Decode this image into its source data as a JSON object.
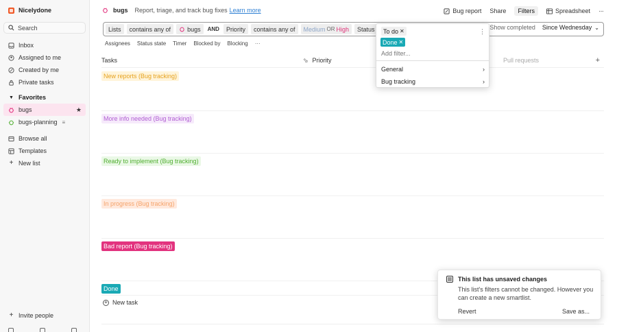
{
  "workspace": {
    "name": "Nicelydone"
  },
  "sidebar": {
    "search_label": "Search",
    "items": [
      {
        "label": "Inbox"
      },
      {
        "label": "Assigned to me"
      },
      {
        "label": "Created by me"
      },
      {
        "label": "Private tasks"
      }
    ],
    "favorites_label": "Favorites",
    "favorites": [
      {
        "label": "bugs"
      },
      {
        "label": "bugs-planning"
      }
    ],
    "more": [
      {
        "label": "Browse all"
      },
      {
        "label": "Templates"
      },
      {
        "label": "New list"
      }
    ],
    "invite_label": "Invite people"
  },
  "header": {
    "title": "bugs",
    "description": "Report, triage, and track bug fixes",
    "learn_more": "Learn more",
    "actions": {
      "bug_report": "Bug report",
      "share": "Share",
      "filters": "Filters",
      "spreadsheet": "Spreadsheet"
    }
  },
  "filterbar": {
    "lists_label": "Lists",
    "contains_any": "contains any of",
    "lists_value": "bugs",
    "and": "AND",
    "priority_label": "Priority",
    "priority_contains": "contains any of",
    "priority_med": "Medium",
    "or": "OR",
    "priority_high": "High",
    "status_label": "Status",
    "show_completed": "Show completed",
    "since": "Since Wednesday"
  },
  "subheader": [
    "Assignees",
    "Status state",
    "Timer",
    "Blocked by",
    "Blocking"
  ],
  "table": {
    "col_tasks": "Tasks",
    "col_priority": "Priority",
    "col_pull": "Pull requests"
  },
  "sections": [
    {
      "label": "New reports (Bug tracking)"
    },
    {
      "label": "More info needed (Bug tracking)"
    },
    {
      "label": "Ready to implement (Bug tracking)"
    },
    {
      "label": "In progress (Bug tracking)"
    },
    {
      "label": "Bad report (Bug tracking)"
    },
    {
      "label": "Done"
    }
  ],
  "new_task": "New task",
  "dropdown": {
    "todo": "To do",
    "done": "Done",
    "add_filter": "Add filter...",
    "items": [
      {
        "label": "General"
      },
      {
        "label": "Bug tracking"
      }
    ]
  },
  "toast": {
    "title": "This list has unsaved changes",
    "body": "This list's filters cannot be changed. However you can create a new smartlist.",
    "revert": "Revert",
    "save": "Save as..."
  },
  "colors": {
    "brand": "#f05a28",
    "active_bg": "#fce4ef",
    "done": "#19a9b5",
    "bad_report": "#e2337e"
  }
}
